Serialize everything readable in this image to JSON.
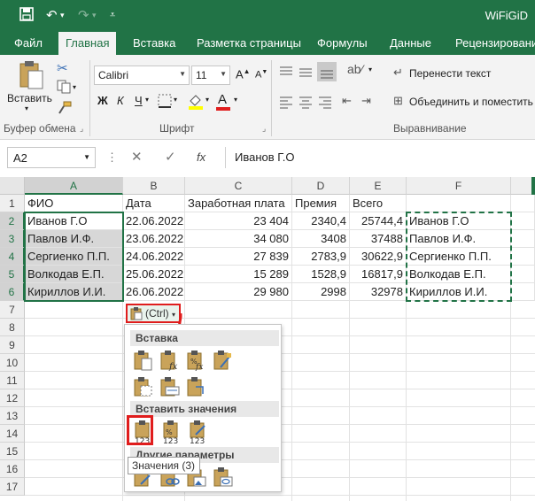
{
  "app": {
    "title": "WiFiGiD"
  },
  "tabs": [
    "Файл",
    "Главная",
    "Вставка",
    "Разметка страницы",
    "Формулы",
    "Данные",
    "Рецензирование"
  ],
  "ribbon": {
    "paste_label": "Вставить",
    "clipboard_label": "Буфер обмена",
    "font_name": "Calibri",
    "font_size": "11",
    "font_label": "Шрифт",
    "bold": "Ж",
    "italic": "К",
    "underline": "Ч",
    "wrap_text": "Перенести текст",
    "merge_center": "Объединить и поместить",
    "alignment_label": "Выравнивание"
  },
  "formula_bar": {
    "name_box": "A2",
    "fx": "fx",
    "value": "Иванов Г.О"
  },
  "columns": [
    "A",
    "B",
    "C",
    "D",
    "E",
    "F"
  ],
  "rows": [
    "1",
    "2",
    "3",
    "4",
    "5",
    "6",
    "7",
    "8",
    "9",
    "10",
    "11",
    "12",
    "13",
    "14",
    "15",
    "16",
    "17"
  ],
  "table": {
    "headers": [
      "ФИО",
      "Дата",
      "Заработная плата",
      "Премия",
      "Всего"
    ],
    "data": [
      [
        "Иванов Г.О",
        "22.06.2022",
        "23 404",
        "2340,4",
        "25744,4",
        "Иванов Г.О"
      ],
      [
        "Павлов И.Ф.",
        "23.06.2022",
        "34 080",
        "3408",
        "37488",
        "Павлов И.Ф."
      ],
      [
        "Сергиенко П.П.",
        "24.06.2022",
        "27 839",
        "2783,9",
        "30622,9",
        "Сергиенко П.П."
      ],
      [
        "Волкодав Е.П.",
        "25.06.2022",
        "15 289",
        "1528,9",
        "16817,9",
        "Волкодав Е.П."
      ],
      [
        "Кириллов И.И.",
        "26.06.2022",
        "29 980",
        "2998",
        "32978",
        "Кириллов И.И."
      ]
    ]
  },
  "paste_options": {
    "button": "(Ctrl)",
    "section_paste": "Вставка",
    "section_values": "Вставить значения",
    "section_other": "Другие параметры вставки",
    "tooltip": "Значения (3)",
    "icon_text": "123"
  },
  "colors": {
    "excel_green": "#217346",
    "highlight_red": "#e01d1d"
  }
}
